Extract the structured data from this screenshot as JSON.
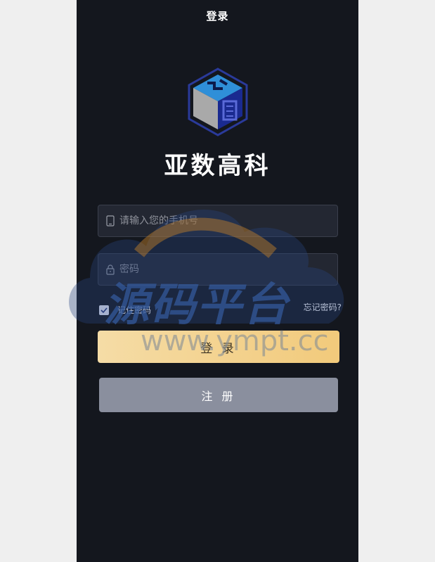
{
  "header": {
    "title": "登录"
  },
  "brand": {
    "name": "亚数高科"
  },
  "form": {
    "phone_placeholder": "请输入您的手机号",
    "password_placeholder": "密码",
    "remember_label": "记住密码",
    "remember_checked": true,
    "forgot_label": "忘记密码?",
    "login_label": "登 录",
    "register_label": "注 册"
  },
  "watermark": {
    "text": "源码平台",
    "url": "www.ympt.cc"
  },
  "colors": {
    "background": "#14171e",
    "login_button": "#f2ca7b",
    "register_button": "#8a8f9e"
  }
}
